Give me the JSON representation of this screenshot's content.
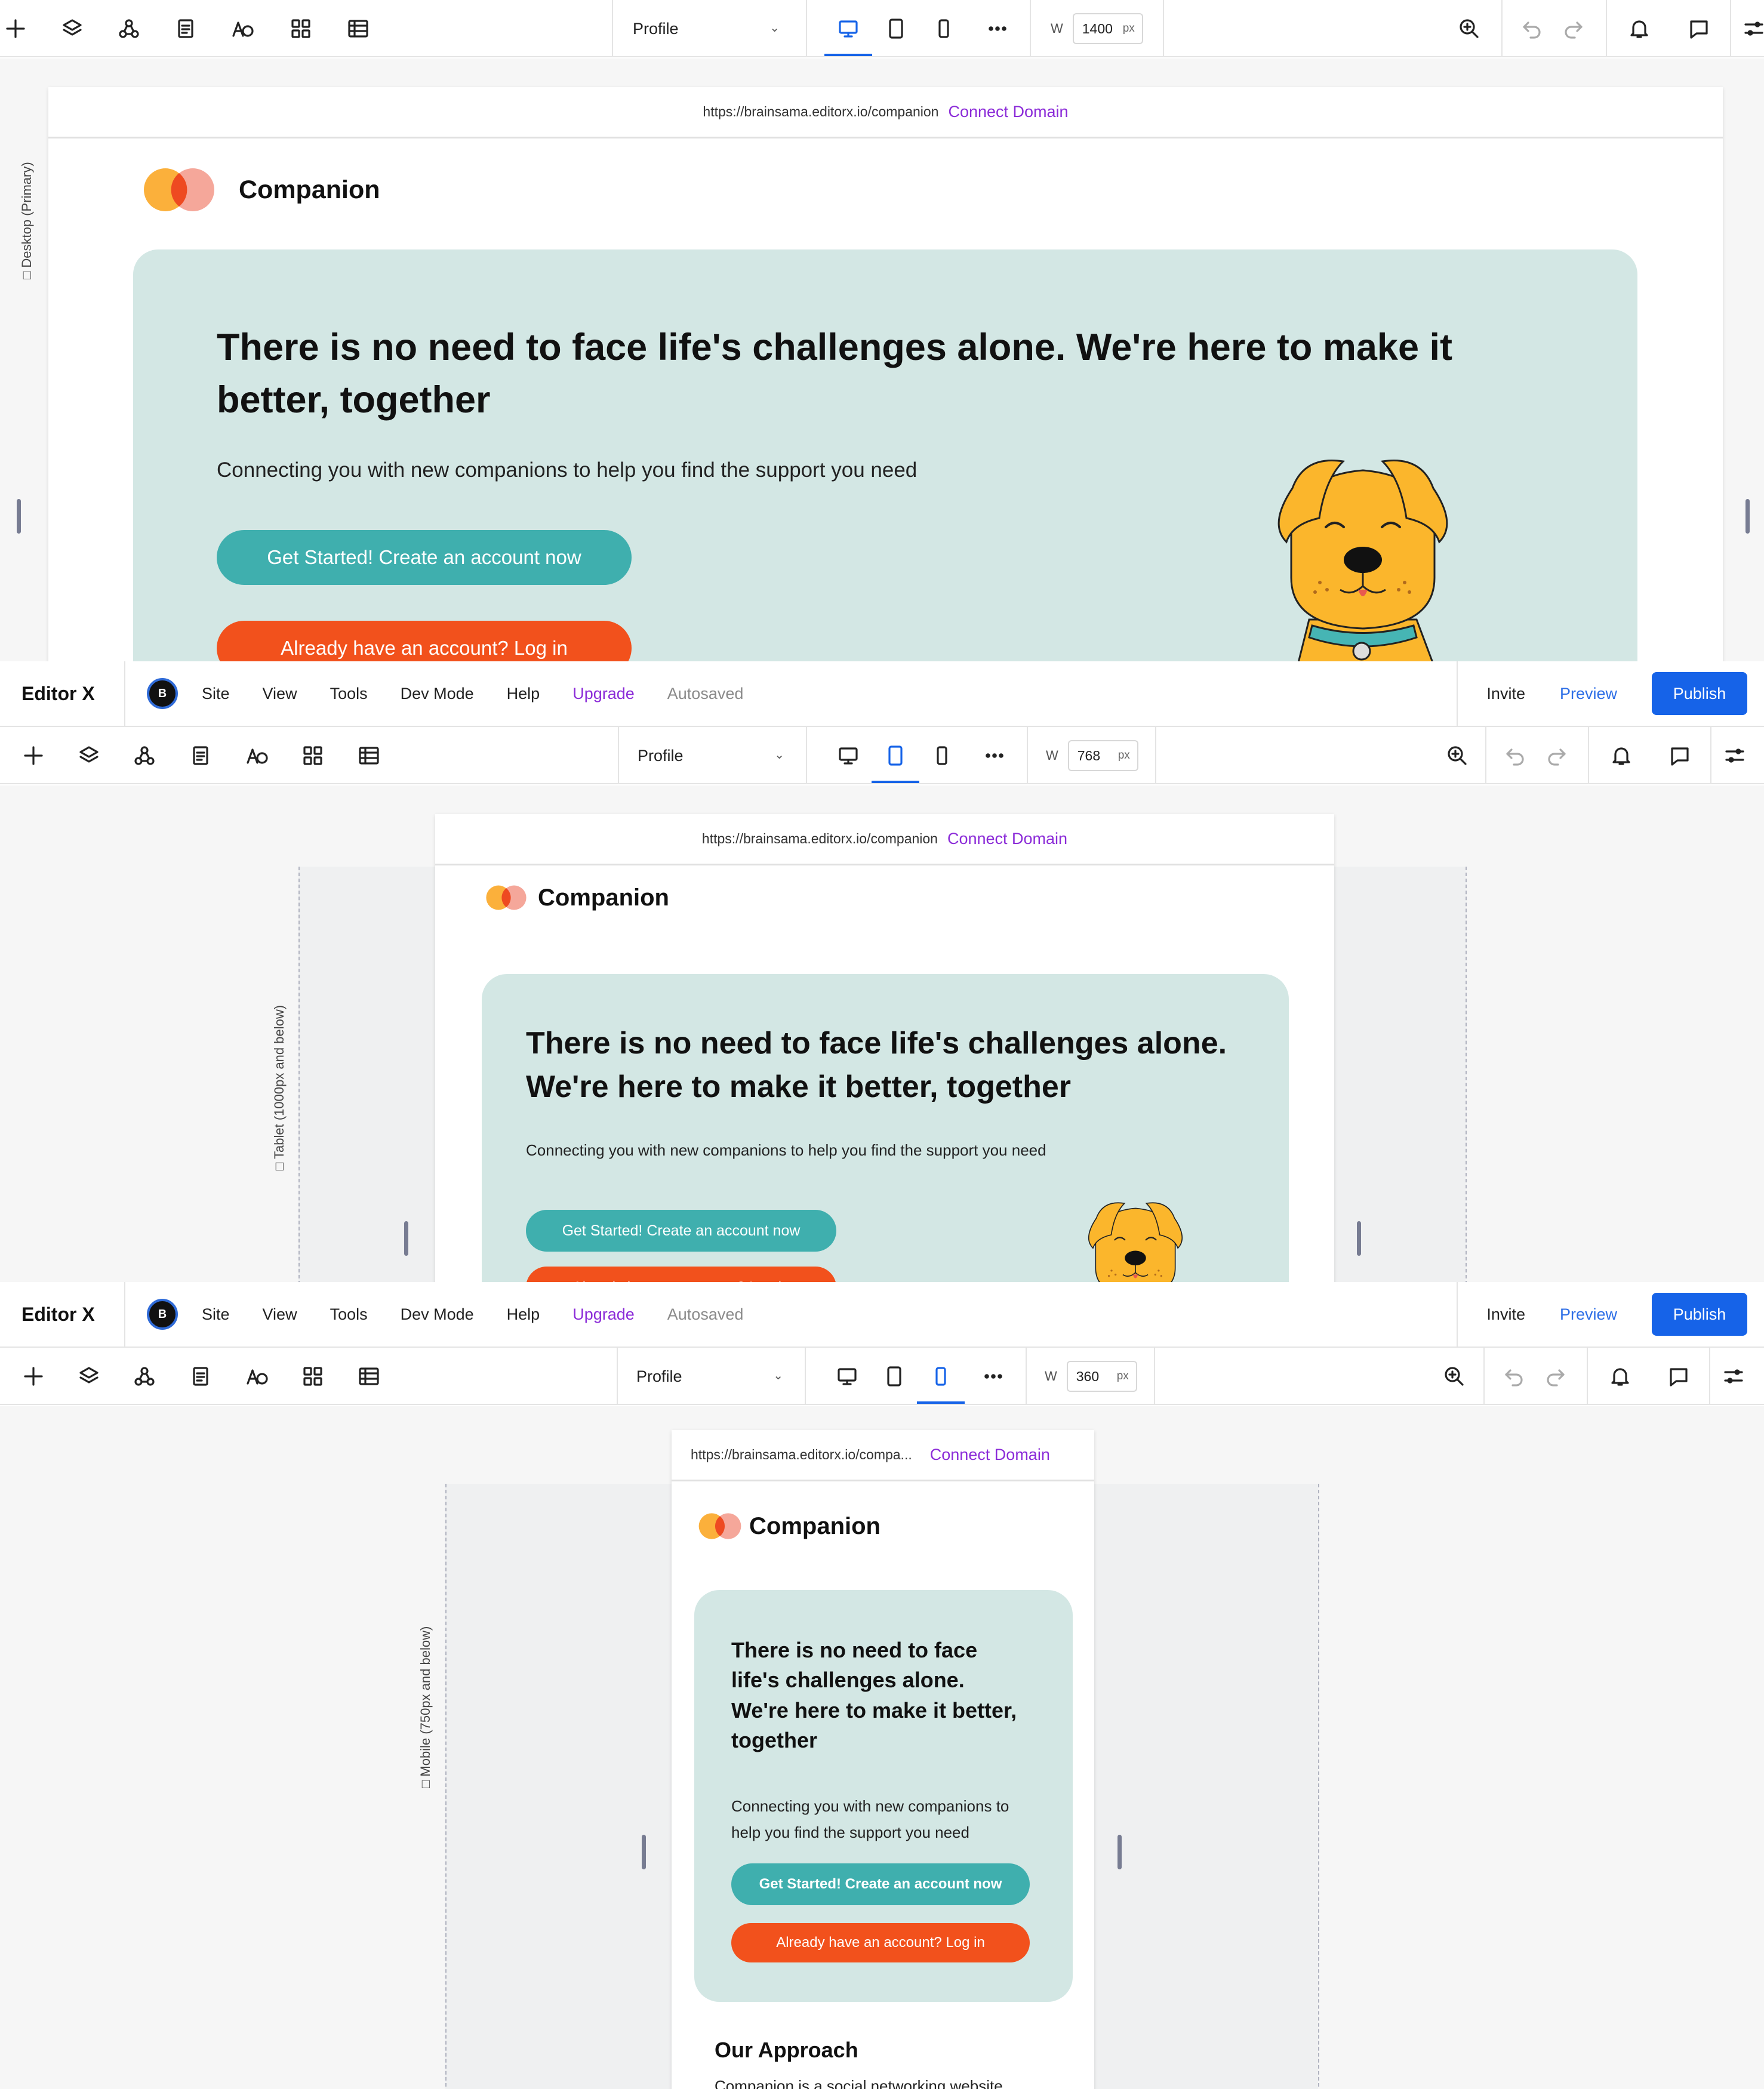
{
  "editor": {
    "logo": "Editor X",
    "avatar_initial": "B",
    "menu": [
      "Site",
      "View",
      "Tools",
      "Dev Mode",
      "Help",
      "Upgrade",
      "Autosaved"
    ],
    "invite": "Invite",
    "preview": "Preview",
    "publish": "Publish"
  },
  "toolbar": {
    "page_select": "Profile",
    "width_label": "W",
    "width_unit": "px",
    "more": "…"
  },
  "site": {
    "url": "https://brainsama.editorx.io/companion",
    "url_truncated": "https://brainsama.editorx.io/compa...",
    "connect_domain": "Connect Domain",
    "brand": "Companion",
    "headline": "There is no need to face life's challenges alone. We're here to make it better, together",
    "subtext": "Connecting you with new companions to help you find the support you need",
    "cta_primary": "Get Started! Create an account now",
    "cta_secondary": "Already have an account? Log in",
    "approach_title": "Our Approach",
    "approach_text": "Companion is a social networking website"
  },
  "breakpoints": [
    {
      "label": "Desktop (Primary)",
      "width": "1400"
    },
    {
      "label": "Tablet (1000px and below)",
      "width": "768"
    },
    {
      "label": "Mobile (750px and below)",
      "width": "360"
    }
  ],
  "colors": {
    "hero_bg": "#d3e7e4",
    "teal": "#3fafae",
    "orange_red": "#f2511c",
    "connect_purple": "#8b2bd8",
    "publish_blue": "#1663e8",
    "logo_orange": "#fbb03b",
    "logo_pink": "#f5a79a",
    "dog_yellow": "#fbb62c"
  }
}
